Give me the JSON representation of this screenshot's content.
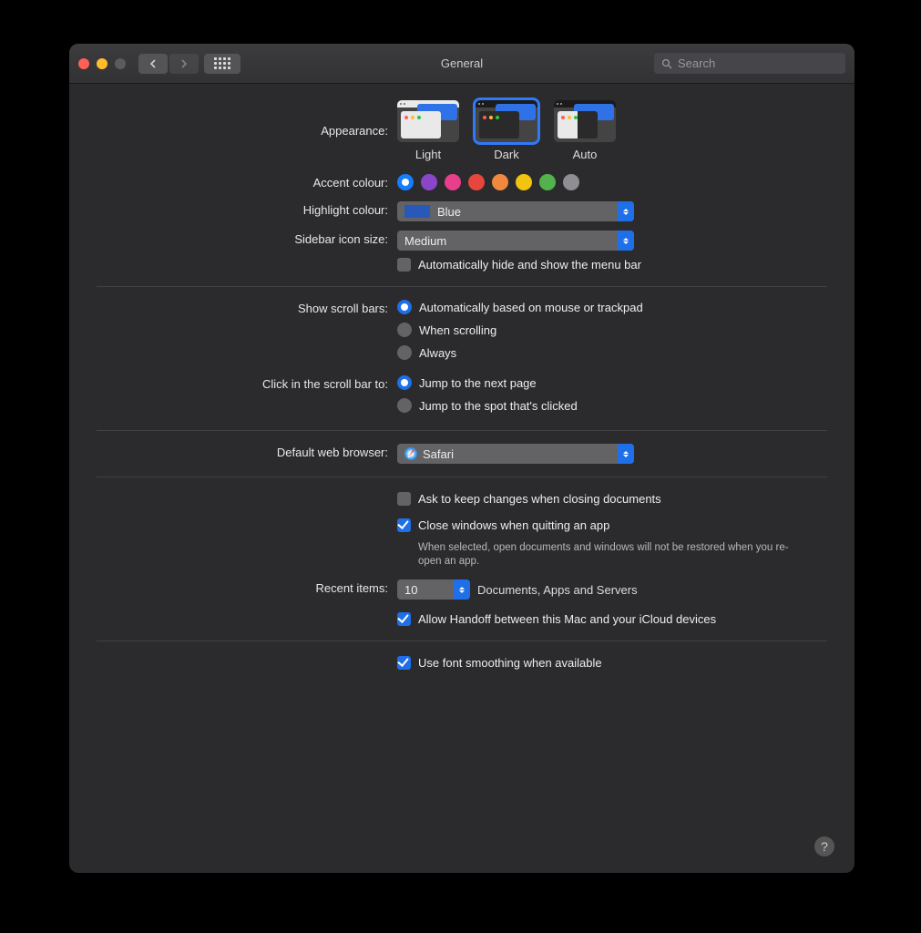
{
  "window": {
    "title": "General",
    "search_placeholder": "Search"
  },
  "appearance": {
    "label": "Appearance:",
    "options": [
      "Light",
      "Dark",
      "Auto"
    ],
    "selected": "Dark"
  },
  "accent": {
    "label": "Accent colour:",
    "colors": [
      "#157efb",
      "#8a46c9",
      "#e83e8c",
      "#e8453c",
      "#f0883e",
      "#f1c40f",
      "#53b24c",
      "#8e8e93"
    ],
    "selected_index": 0
  },
  "highlight": {
    "label": "Highlight colour:",
    "value": "Blue"
  },
  "sidebar_icon": {
    "label": "Sidebar icon size:",
    "value": "Medium"
  },
  "auto_hide_menubar": {
    "label": "Automatically hide and show the menu bar",
    "checked": false
  },
  "scrollbars": {
    "label": "Show scroll bars:",
    "options": [
      "Automatically based on mouse or trackpad",
      "When scrolling",
      "Always"
    ],
    "selected_index": 0
  },
  "click_scroll": {
    "label": "Click in the scroll bar to:",
    "options": [
      "Jump to the next page",
      "Jump to the spot that's clicked"
    ],
    "selected_index": 0
  },
  "browser": {
    "label": "Default web browser:",
    "value": "Safari"
  },
  "ask_changes": {
    "label": "Ask to keep changes when closing documents",
    "checked": false
  },
  "close_windows": {
    "label": "Close windows when quitting an app",
    "checked": true,
    "hint": "When selected, open documents and windows will not be restored when you re-open an app."
  },
  "recent": {
    "label": "Recent items:",
    "value": "10",
    "suffix": "Documents, Apps and Servers"
  },
  "handoff": {
    "label": "Allow Handoff between this Mac and your iCloud devices",
    "checked": true
  },
  "font_smoothing": {
    "label": "Use font smoothing when available",
    "checked": true
  },
  "help_tooltip": "?"
}
